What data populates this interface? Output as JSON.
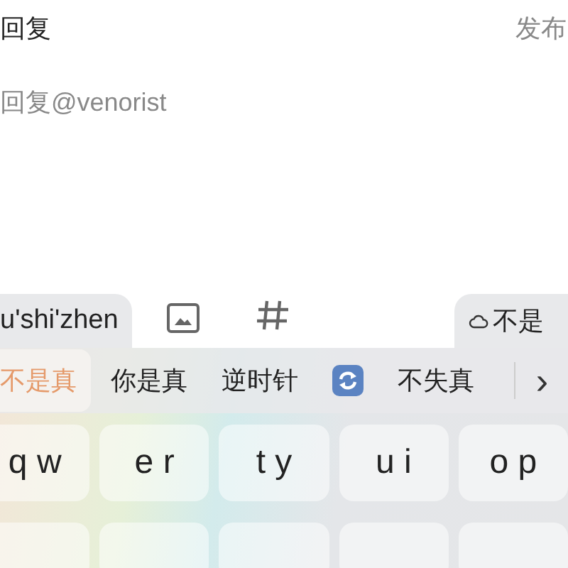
{
  "header": {
    "title": "回复",
    "publish": "发布"
  },
  "reply_field": {
    "placeholder": "回复@venorist"
  },
  "toolbar": {
    "pinyin": "u'shi'zhen",
    "suggestion": "不是"
  },
  "candidates": [
    {
      "kind": "text",
      "label": "不是真",
      "selected": true
    },
    {
      "kind": "text",
      "label": "你是真",
      "selected": false
    },
    {
      "kind": "text",
      "label": "逆时针",
      "selected": false
    },
    {
      "kind": "app"
    },
    {
      "kind": "text",
      "label": "不失真",
      "selected": false
    }
  ],
  "more": "›",
  "keys": [
    "q w",
    "e r",
    "t y",
    "u i",
    "o p"
  ]
}
